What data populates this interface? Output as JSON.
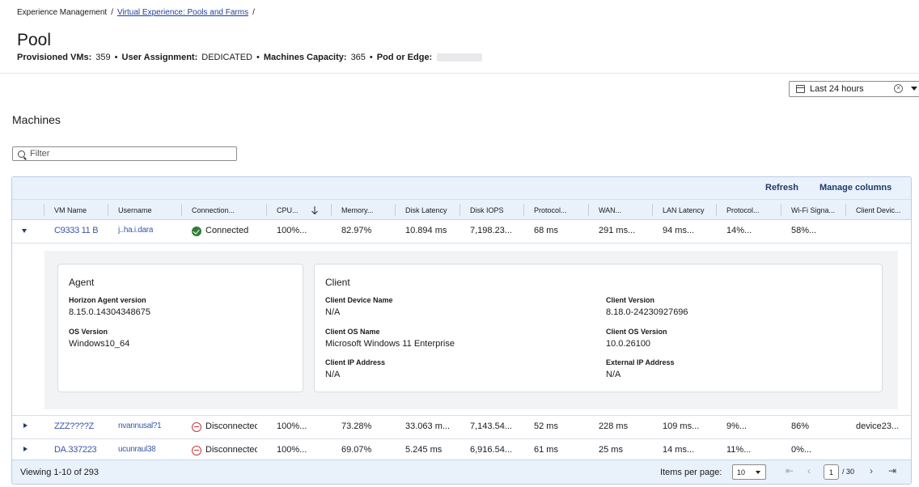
{
  "breadcrumb": {
    "root": "Experience Management",
    "link": "Virtual Experience: Pools and Farms",
    "sep": "/"
  },
  "page": {
    "title": "Pool",
    "meta": [
      {
        "key": "Provisioned VMs:",
        "value": "359"
      },
      {
        "key": "User Assignment:",
        "value": "DEDICATED"
      },
      {
        "key": "Machines Capacity:",
        "value": "365"
      },
      {
        "key": "Pod or Edge:",
        "value": ""
      }
    ],
    "meta_sep": "•"
  },
  "time_picker": {
    "value": "Last 24 hours",
    "icon": "calendar-icon"
  },
  "machines": {
    "title": "Machines",
    "filter_placeholder": "Filter",
    "toolbar": {
      "refresh": "Refresh",
      "manage_columns": "Manage columns"
    },
    "columns": [
      "VM Name",
      "Username",
      "Connection...",
      "CPU...",
      "Memory...",
      "Disk Latency",
      "Disk IOPS",
      "Protocol...",
      "WAN...",
      "LAN Latency",
      "Protocol...",
      "Wi-Fi Signa...",
      "Client Devic..."
    ],
    "rows": [
      {
        "vm": "C9333 11 B",
        "user": "j..ha.i.dara",
        "status": "Connected",
        "cpu": "100%...",
        "mem": "82.97%",
        "disk_lat": "10.894 ms",
        "iops": "7,198.23...",
        "proto": "68 ms",
        "wan": "291 ms...",
        "lan": "94 ms...",
        "proto2": "14%...",
        "wifi": "58%...",
        "client": ""
      },
      {
        "vm": "ZZZ????Z",
        "user": "nvannusal?1",
        "status": "Disconnected",
        "cpu": "100%...",
        "mem": "73.28%",
        "disk_lat": "33.063 m...",
        "iops": "7,143.54...",
        "proto": "52 ms",
        "wan": "228 ms",
        "lan": "109 ms...",
        "proto2": "9%...",
        "wifi": "86%",
        "client": "device23..."
      },
      {
        "vm": "DA.337223",
        "user": "ucunraul38",
        "status": "Disconnected",
        "cpu": "100%...",
        "mem": "69.07%",
        "disk_lat": "5.245 ms",
        "iops": "6,916.54...",
        "proto": "61 ms",
        "wan": "25 ms",
        "lan": "14 ms...",
        "proto2": "11%...",
        "wifi": "0%...",
        "client": ""
      }
    ],
    "detail": {
      "agent": {
        "title": "Agent",
        "fields": [
          {
            "label": "Horizon Agent version",
            "value": "8.15.0.14304348675"
          },
          {
            "label": "OS Version",
            "value": "Windows10_64"
          }
        ]
      },
      "client": {
        "title": "Client",
        "fields": [
          {
            "label": "Client Device Name",
            "value": "N/A"
          },
          {
            "label": "Client Version",
            "value": "8.18.0-24230927696"
          },
          {
            "label": "Client OS Name",
            "value": "Microsoft Windows 11 Enterprise"
          },
          {
            "label": "Client OS Version",
            "value": "10.0.26100"
          },
          {
            "label": "Client IP Address",
            "value": "N/A"
          },
          {
            "label": "External IP Address",
            "value": "N/A"
          }
        ]
      }
    },
    "footer": {
      "viewing": "Viewing 1-10 of 293",
      "items_per_page_label": "Items per page:",
      "items_per_page": "10",
      "page": "1",
      "page_total": "/ 30"
    }
  },
  "colors": {
    "accent": "#1f3a6e",
    "header_bg": "#e9f1fb",
    "connected": "#2e7d32",
    "disconnected": "#c23b3b"
  }
}
